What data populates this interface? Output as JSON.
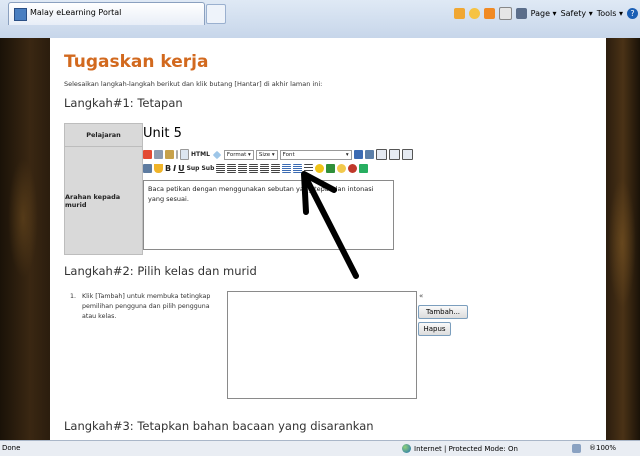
{
  "browser": {
    "tab_title": "Malay eLearning Portal",
    "commands": {
      "page": "Page ▾",
      "safety": "Safety ▾",
      "tools": "Tools ▾"
    }
  },
  "page": {
    "title": "Tugaskan kerja",
    "instruction": "Selesaikan langkah-langkah berikut dan klik butang [Hantar] di akhir laman ini:",
    "step1": {
      "heading": "Langkah#1: Tetapan",
      "subject_label": "Pelajaran",
      "subject_value": "Unit 5",
      "instruction_label": "Arahan kepada murid",
      "editor": {
        "html_label": "HTML",
        "format": "Format",
        "size": "Size",
        "font": "Font",
        "sup": "Sup",
        "sub": "Sub",
        "content": "Baca petikan dengan menggunakan sebutan yang tepat dan intonasi yang sesuai."
      }
    },
    "step2": {
      "heading": "Langkah#2: Pilih kelas dan murid",
      "item_number": "1.",
      "item_text": "Klik [Tambah] untuk membuka tetingkap pemilihan pengguna dan pilih pengguna atau kelas.",
      "chevron": "«",
      "add_button": "Tambah...",
      "remove_button": "Hapus"
    },
    "step3": {
      "heading": "Langkah#3: Tetapkan bahan bacaan yang disarankan"
    }
  },
  "status": {
    "done": "Done",
    "zone": "Internet | Protected Mode: On",
    "zoom": "®100%"
  }
}
